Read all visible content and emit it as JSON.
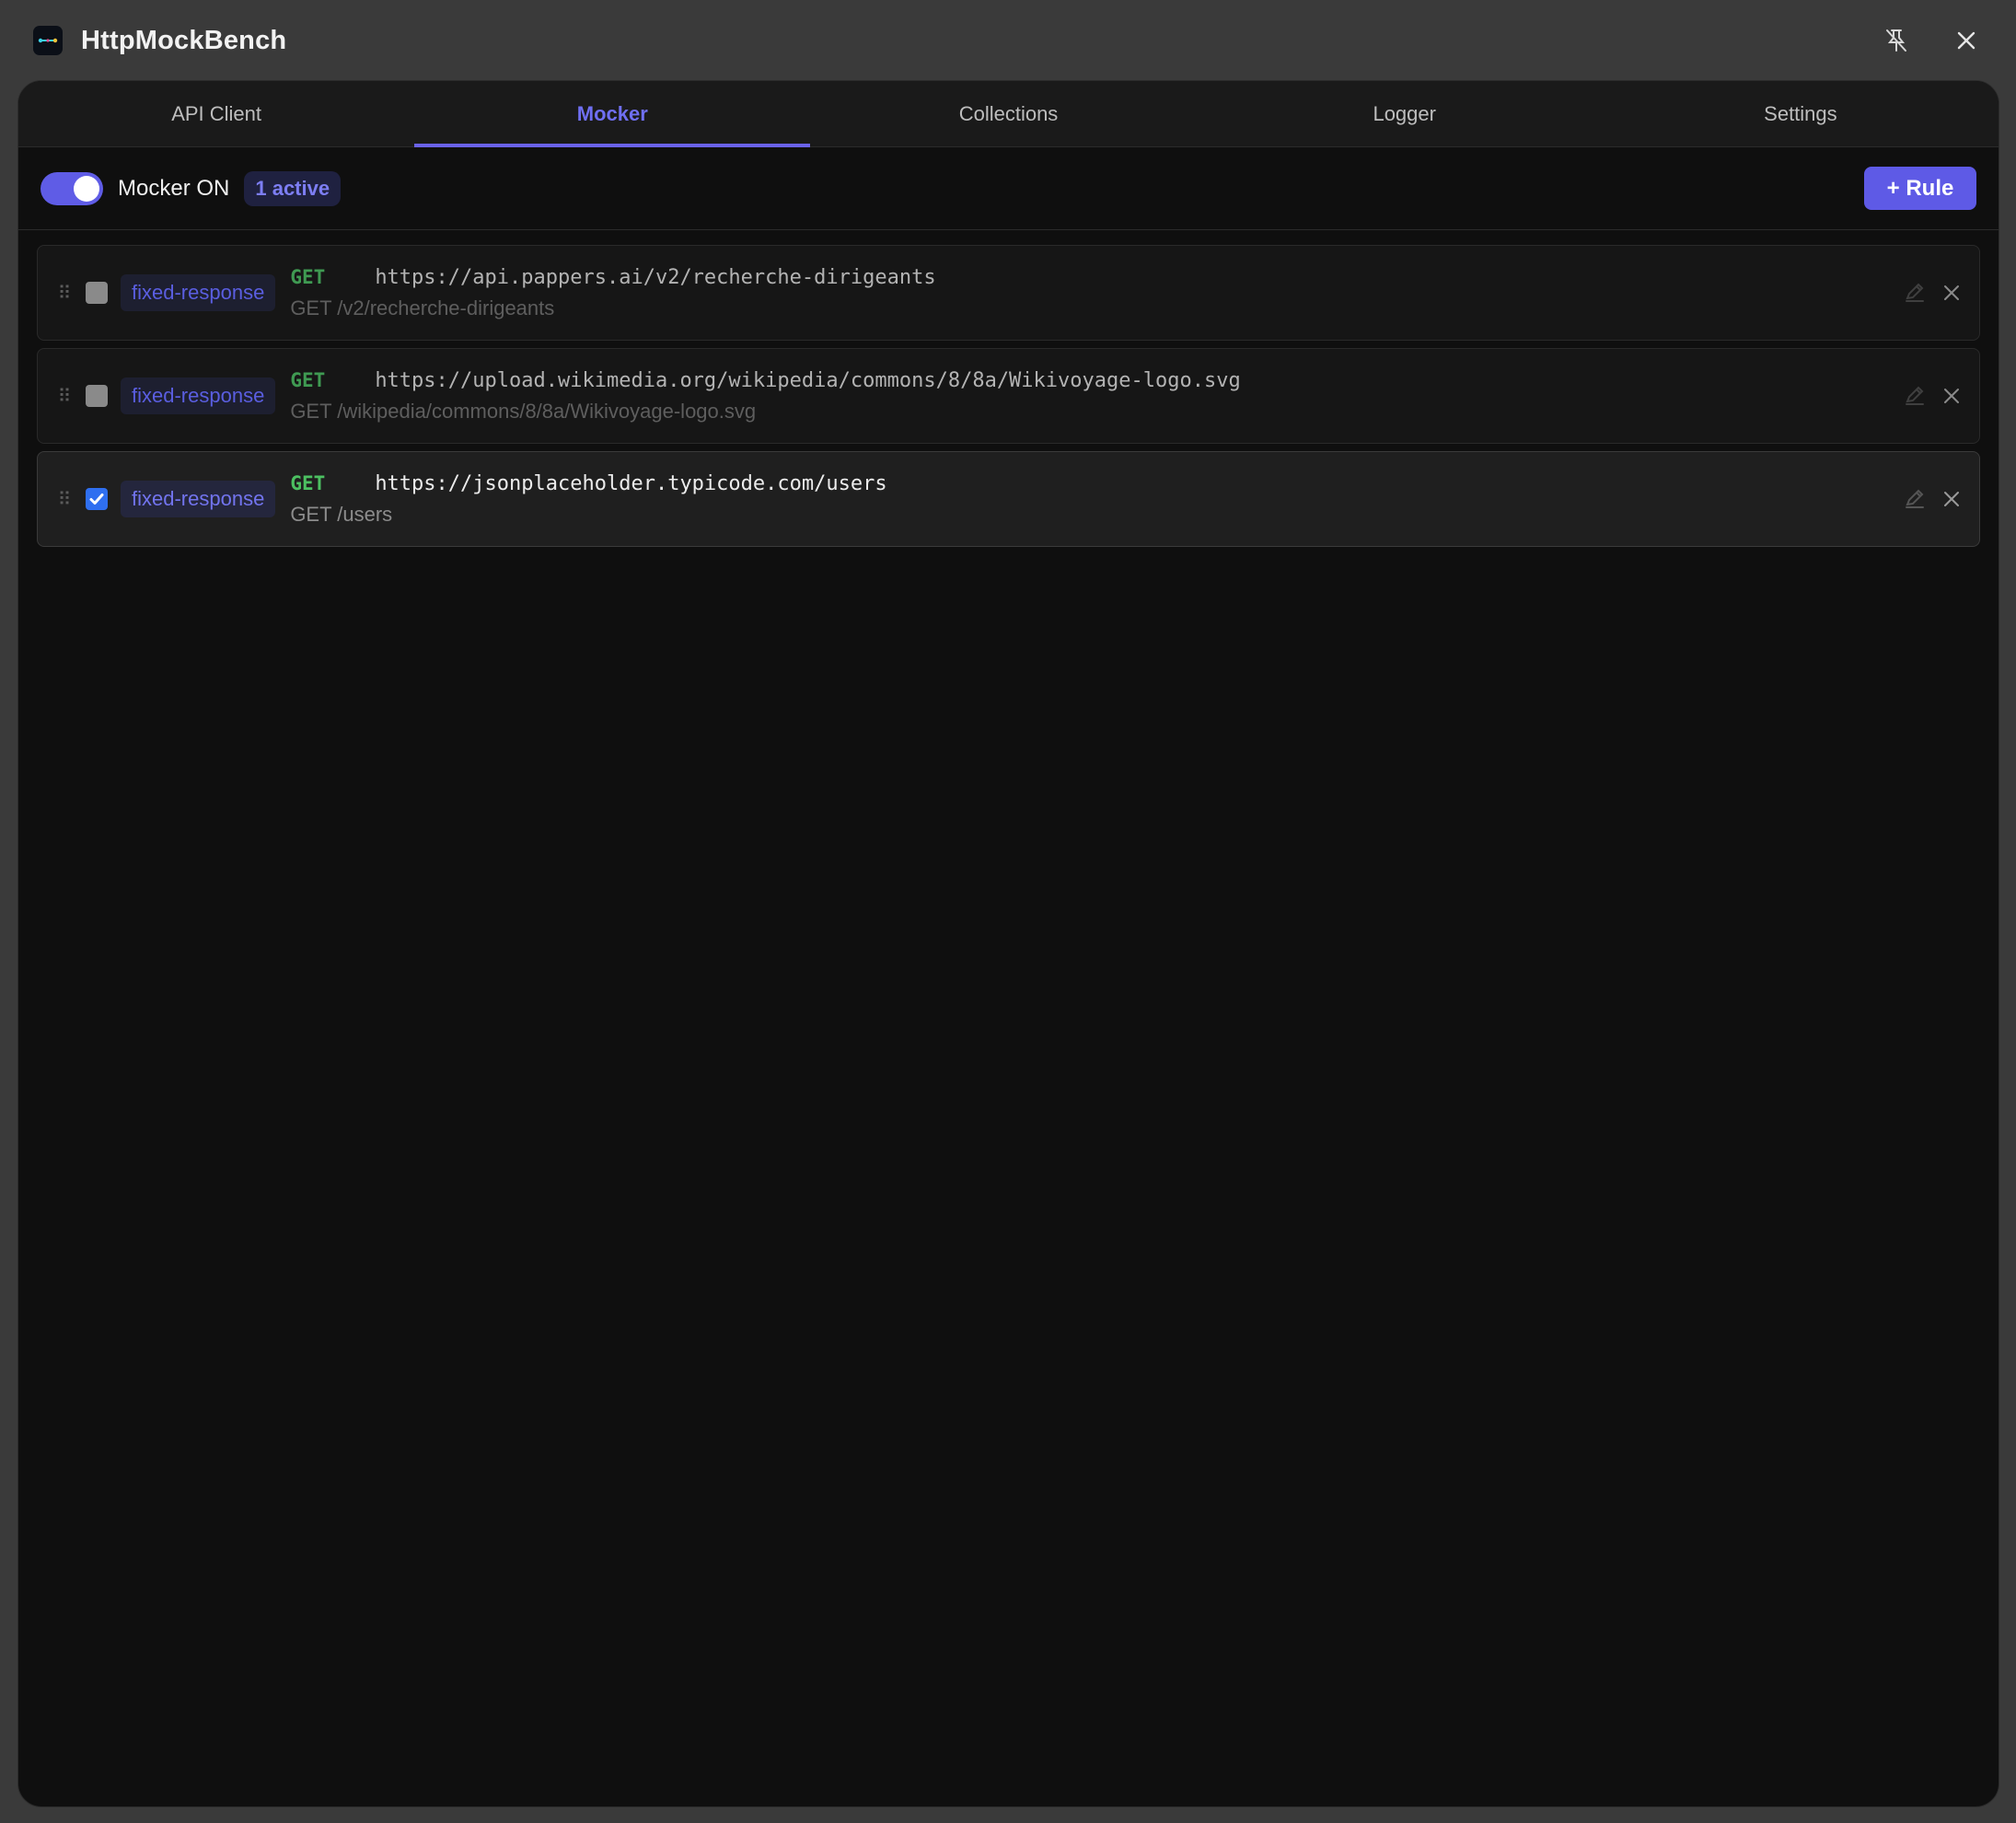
{
  "app": {
    "title": "HttpMockBench",
    "logo_icon": "app-logo-icon"
  },
  "window_controls": {
    "unpin_icon": "unpin-icon",
    "close_icon": "close-icon"
  },
  "tabs": [
    {
      "label": "API Client",
      "active": false
    },
    {
      "label": "Mocker",
      "active": true
    },
    {
      "label": "Collections",
      "active": false
    },
    {
      "label": "Logger",
      "active": false
    },
    {
      "label": "Settings",
      "active": false
    }
  ],
  "toolbar": {
    "toggle_on": true,
    "toggle_label": "Mocker ON",
    "active_badge": "1 active",
    "add_rule_label": "+ Rule"
  },
  "rules": [
    {
      "type": "fixed-response",
      "method": "GET",
      "url": "https://api.pappers.ai/v2/recherche-dirigeants",
      "summary": "GET /v2/recherche-dirigeants",
      "enabled": false
    },
    {
      "type": "fixed-response",
      "method": "GET",
      "url": "https://upload.wikimedia.org/wikipedia/commons/8/8a/Wikivoyage-logo.svg",
      "summary": "GET /wikipedia/commons/8/8a/Wikivoyage-logo.svg",
      "enabled": false
    },
    {
      "type": "fixed-response",
      "method": "GET",
      "url": "https://jsonplaceholder.typicode.com/users",
      "summary": "GET /users",
      "enabled": true
    }
  ],
  "colors": {
    "accent": "#5e5ae6",
    "method_get": "#4cc061",
    "checkbox_checked": "#2f6ff0",
    "background": "#0f0f0f"
  }
}
